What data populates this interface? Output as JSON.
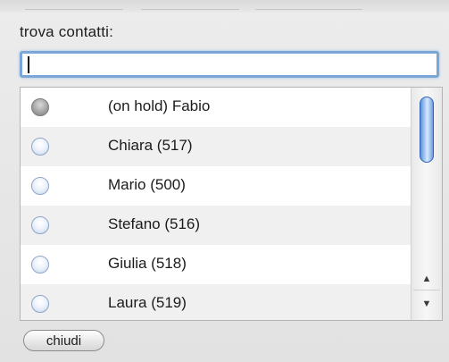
{
  "search": {
    "label": "trova contatti:",
    "value": "",
    "placeholder": ""
  },
  "contacts": [
    {
      "name": "(on hold) Fabio",
      "status": "on-hold"
    },
    {
      "name": "Chiara (517)",
      "status": "available"
    },
    {
      "name": "Mario (500)",
      "status": "available"
    },
    {
      "name": "Stefano (516)",
      "status": "available"
    },
    {
      "name": "Giulia (518)",
      "status": "available"
    },
    {
      "name": "Laura (519)",
      "status": "available"
    }
  ],
  "scroll": {
    "up_icon": "▲",
    "down_icon": "▼"
  },
  "footer": {
    "close_label": "chiudi"
  },
  "colors": {
    "focus_ring": "#7aa7d8",
    "scroll_thumb": "#5b8fd8",
    "row_alt": "#f0f0f0"
  }
}
